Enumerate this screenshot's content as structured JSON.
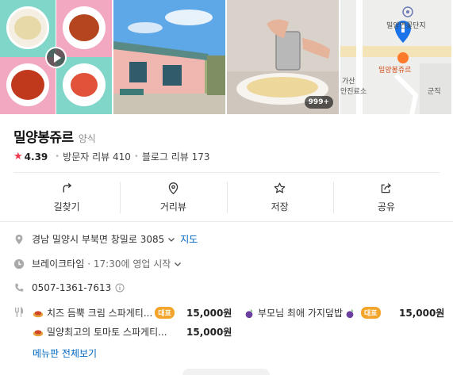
{
  "photos": {
    "count_badge": "999+",
    "map_labels": [
      "밀양연꽃단지",
      "밀양봉쥬르",
      "가산",
      "안진료소",
      "군직"
    ]
  },
  "place": {
    "name": "밀양봉쥬르",
    "category": "양식",
    "rating": "4.39",
    "visitor_reviews": "방문자 리뷰 410",
    "blog_reviews": "블로그 리뷰 173"
  },
  "actions": [
    {
      "label": "길찾기",
      "icon": "directions-icon"
    },
    {
      "label": "거리뷰",
      "icon": "street-view-icon"
    },
    {
      "label": "저장",
      "icon": "star-outline-icon"
    },
    {
      "label": "공유",
      "icon": "share-icon"
    }
  ],
  "info": {
    "address": "경남 밀양시 부북면 창밀로 3085",
    "map_link": "지도",
    "hours_status": "브레이크타임",
    "hours_detail": "· 17:30에 영업 시작",
    "phone": "0507-1361-7613"
  },
  "menu": {
    "items": [
      {
        "name": "치즈 듬뿍 크림 스파게티...",
        "tag": "대표",
        "price": "15,000원"
      },
      {
        "name": "부모님 최애 가지덮밥",
        "tag": "대표",
        "price": "15,000원"
      },
      {
        "name": "밀양최고의 토마토 스파게티...",
        "tag": "",
        "price": "15,000원"
      }
    ],
    "more_label": "메뉴판 전체보기"
  },
  "colors": {
    "link": "#0068c3",
    "star": "#f0374b",
    "tag": "#f3a52b",
    "map_pin": "#1a73e8"
  }
}
